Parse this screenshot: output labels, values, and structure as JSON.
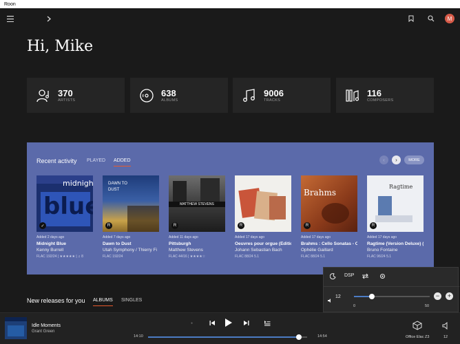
{
  "window": {
    "title": "Roon"
  },
  "greeting": "Hi, Mike",
  "avatar_letter": "M",
  "stats": [
    {
      "value": "370",
      "label": "ARTISTS"
    },
    {
      "value": "638",
      "label": "ALBUMS"
    },
    {
      "value": "9006",
      "label": "TRACKS"
    },
    {
      "value": "116",
      "label": "COMPOSERS"
    }
  ],
  "recent": {
    "title": "Recent activity",
    "tabs": [
      "PLAYED",
      "ADDED"
    ],
    "more": "MORE",
    "cards": [
      {
        "added": "Added 2 days ago",
        "title": "Midnight Blue",
        "artist": "Kenny Burrell",
        "format": "FLAC 192/24 | ★★★★★ | ♫ 8",
        "cover_text": "blue"
      },
      {
        "added": "Added 7 days ago",
        "title": "Dawn to Dust",
        "artist": "Utah Symphony / Thierry Fi",
        "format": "FLAC 192/24",
        "cover_text": "DAWN TO DUST"
      },
      {
        "added": "Added 11 days ago",
        "title": "Pittsburgh",
        "artist": "Matthew Stevens",
        "format": "FLAC 44/16 | ★★★★☆",
        "cover_text": "MATTHEW STEVENS"
      },
      {
        "added": "Added 17 days ago",
        "title": "Oeuvres pour orgue (Édition",
        "artist": "Johann Sebastian Bach",
        "format": "FLAC 88/24 5.1",
        "cover_text": ""
      },
      {
        "added": "Added 17 days ago",
        "title": "Brahms : Cello Sonatas - Cla",
        "artist": "Ophélie Gaillard",
        "format": "FLAC 88/24 5.1",
        "cover_text": "Brahms"
      },
      {
        "added": "Added 17 days ago",
        "title": "Ragtime (Version Deluxe) (Ée",
        "artist": "Bruno Fontaine",
        "format": "FLAC 96/24 5.1",
        "cover_text": "Ragtime"
      }
    ]
  },
  "new_releases": {
    "title": "New releases for you",
    "tabs": [
      "ALBUMS",
      "SINGLES"
    ]
  },
  "volume_popup": {
    "dsp": "DSP",
    "volume": "12",
    "min": "0",
    "max": "50",
    "level_fraction": 0.24
  },
  "player": {
    "song": "Idle Moments",
    "artist": "Grant Green",
    "elapsed": "14:10",
    "total": "14:54",
    "progress_fraction": 0.95,
    "zone": "Office Elac Z3",
    "volume": "12"
  }
}
